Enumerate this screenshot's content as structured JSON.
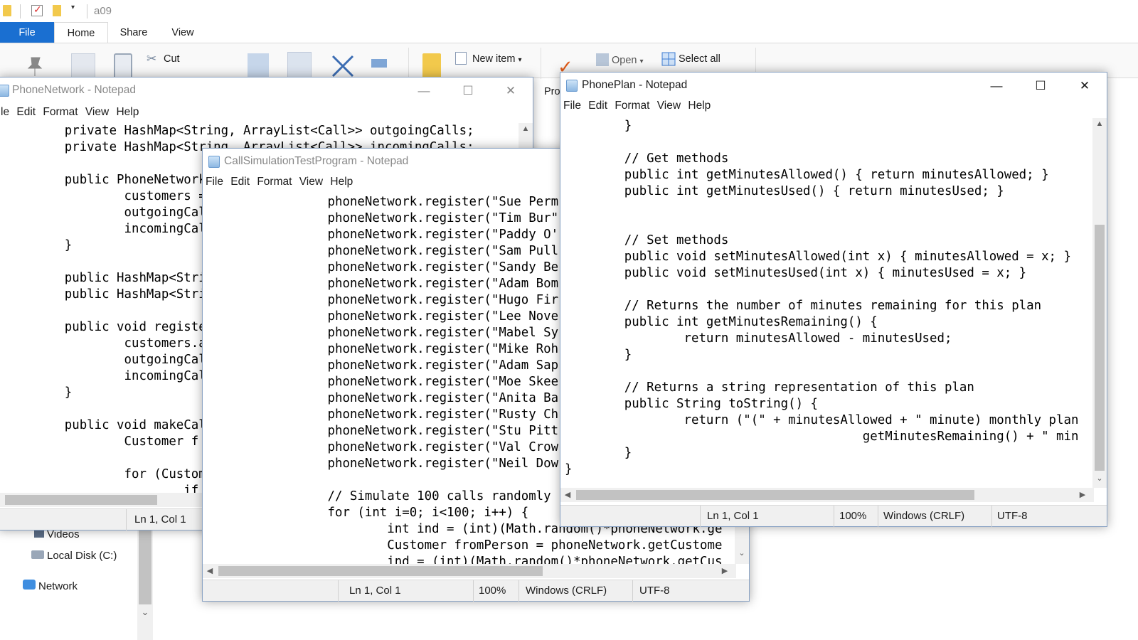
{
  "explorer": {
    "title": "a09",
    "tabs": [
      "File",
      "Home",
      "Share",
      "View"
    ],
    "ribbon": {
      "cut": "Cut",
      "new_item": "New item",
      "open": "Open",
      "select_all": "Select all",
      "properties_partial": "Pro"
    },
    "nav": [
      "Videos",
      "Local Disk (C:)",
      "Network"
    ]
  },
  "phone_network": {
    "title": "PhoneNetwork - Notepad",
    "menu": [
      "le",
      "Edit",
      "Format",
      "View",
      "Help"
    ],
    "lines": [
      "        private HashMap<String, ArrayList<Call>> outgoingCalls;",
      "        private HashMap<String, ArrayList<Call>> incomingCalls;",
      "",
      "        public PhoneNetwork()",
      "                customers =",
      "                outgoingCall",
      "                incomingCall",
      "        }",
      "",
      "        public HashMap<Strin",
      "        public HashMap<Strin",
      "",
      "        public void register",
      "                customers.ad",
      "                outgoingCall",
      "                incomingCall",
      "        }",
      "",
      "        public void makeCall",
      "                Customer f =",
      "",
      "                for (Custome",
      "                        if ("
    ],
    "status": {
      "position": "Ln 1, Col 1"
    }
  },
  "call_sim": {
    "title": "CallSimulationTestProgram - Notepad",
    "menu": [
      "File",
      "Edit",
      "Format",
      "View",
      "Help"
    ],
    "lines": [
      "                phoneNetwork.register(\"Sue Perm",
      "                phoneNetwork.register(\"Tim Bur\"",
      "                phoneNetwork.register(\"Paddy O'",
      "                phoneNetwork.register(\"Sam Pull",
      "                phoneNetwork.register(\"Sandy Be",
      "                phoneNetwork.register(\"Adam Bom",
      "                phoneNetwork.register(\"Hugo Fir",
      "                phoneNetwork.register(\"Lee Nove",
      "                phoneNetwork.register(\"Mabel Sy",
      "                phoneNetwork.register(\"Mike Roh",
      "                phoneNetwork.register(\"Adam Sap",
      "                phoneNetwork.register(\"Moe Skee",
      "                phoneNetwork.register(\"Anita Ba",
      "                phoneNetwork.register(\"Rusty Ch",
      "                phoneNetwork.register(\"Stu Pitt",
      "                phoneNetwork.register(\"Val Crow",
      "                phoneNetwork.register(\"Neil Dow",
      "",
      "                // Simulate 100 calls randomly",
      "                for (int i=0; i<100; i++) {",
      "                        int ind = (int)(Math.random()*phoneNetwork.ge",
      "                        Customer fromPerson = phoneNetwork.getCustome",
      "                        ind = (int)(Math.random()*phoneNetwork.getCus"
    ],
    "status": {
      "position": "Ln 1, Col 1",
      "zoom": "100%",
      "eol": "Windows (CRLF)",
      "encoding": "UTF-8"
    }
  },
  "phone_plan": {
    "title": "PhonePlan - Notepad",
    "menu": [
      "File",
      "Edit",
      "Format",
      "View",
      "Help"
    ],
    "lines": [
      "        }",
      "",
      "        // Get methods",
      "        public int getMinutesAllowed() { return minutesAllowed; }",
      "        public int getMinutesUsed() { return minutesUsed; }",
      "",
      "",
      "        // Set methods",
      "        public void setMinutesAllowed(int x) { minutesAllowed = x; }",
      "        public void setMinutesUsed(int x) { minutesUsed = x; }",
      "",
      "        // Returns the number of minutes remaining for this plan",
      "        public int getMinutesRemaining() {",
      "                return minutesAllowed - minutesUsed;",
      "        }",
      "",
      "        // Returns a string representation of this plan",
      "        public String toString() {",
      "                return (\"(\" + minutesAllowed + \" minute) monthly plan",
      "                                        getMinutesRemaining() + \" min",
      "        }",
      "}"
    ],
    "status": {
      "position": "Ln 1, Col 1",
      "zoom": "100%",
      "eol": "Windows (CRLF)",
      "encoding": "UTF-8"
    }
  },
  "window_controls": {
    "minimize": "—",
    "maximize": "☐",
    "close": "✕"
  },
  "colors": {
    "file_tab": "#1a6fd1",
    "accent_border": "#8aa3c4"
  }
}
